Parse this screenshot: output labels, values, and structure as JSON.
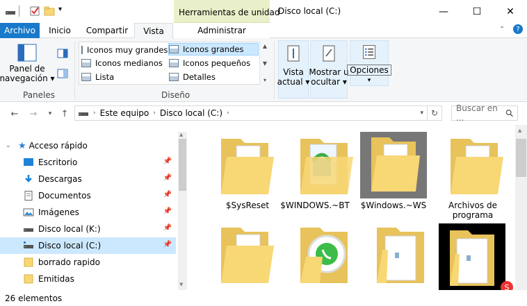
{
  "window": {
    "title": "Disco local (C:)",
    "context_tab_header": "Herramientas de unidad",
    "minimize": "—",
    "maximize": "☐",
    "close": "✕"
  },
  "tabs": {
    "archivo": "Archivo",
    "inicio": "Inicio",
    "compartir": "Compartir",
    "vista": "Vista",
    "administrar": "Administrar"
  },
  "ribbon": {
    "panel_nav_line1": "Panel de",
    "panel_nav_line2": "navegación",
    "paneles_label": "Paneles",
    "layout_items": {
      "muy_grandes": "Iconos muy grandes",
      "grandes": "Iconos grandes",
      "medianos": "Iconos medianos",
      "pequenos": "Iconos pequeños",
      "lista": "Lista",
      "detalles": "Detalles"
    },
    "diseno_label": "Diseño",
    "vista_actual_line1": "Vista",
    "vista_actual_line2": "actual",
    "mostrar_line1": "Mostrar u",
    "mostrar_line2": "ocultar",
    "opciones": "Opciones"
  },
  "address": {
    "crumb1": "Este equipo",
    "crumb2": "Disco local (C:)",
    "search_placeholder": "Buscar en ..."
  },
  "nav": {
    "quick_access": "Acceso rápido",
    "items": [
      "Escritorio",
      "Descargas",
      "Documentos",
      "Imágenes",
      "Disco local (K:)",
      "Disco local (C:)",
      "borrado rapido",
      "Emitidas"
    ]
  },
  "files": [
    "$SysReset",
    "$WINDOWS.~BT",
    "$Windows.~WS",
    "Archivos de programa"
  ],
  "files_row2_count": 4,
  "status": {
    "count": "26 elementos"
  },
  "colors": {
    "accent": "#1979ca",
    "context_tab": "#e9f0c9",
    "selection": "#cce8ff",
    "folder": "#f8d775"
  },
  "watermark": "Solvetic"
}
